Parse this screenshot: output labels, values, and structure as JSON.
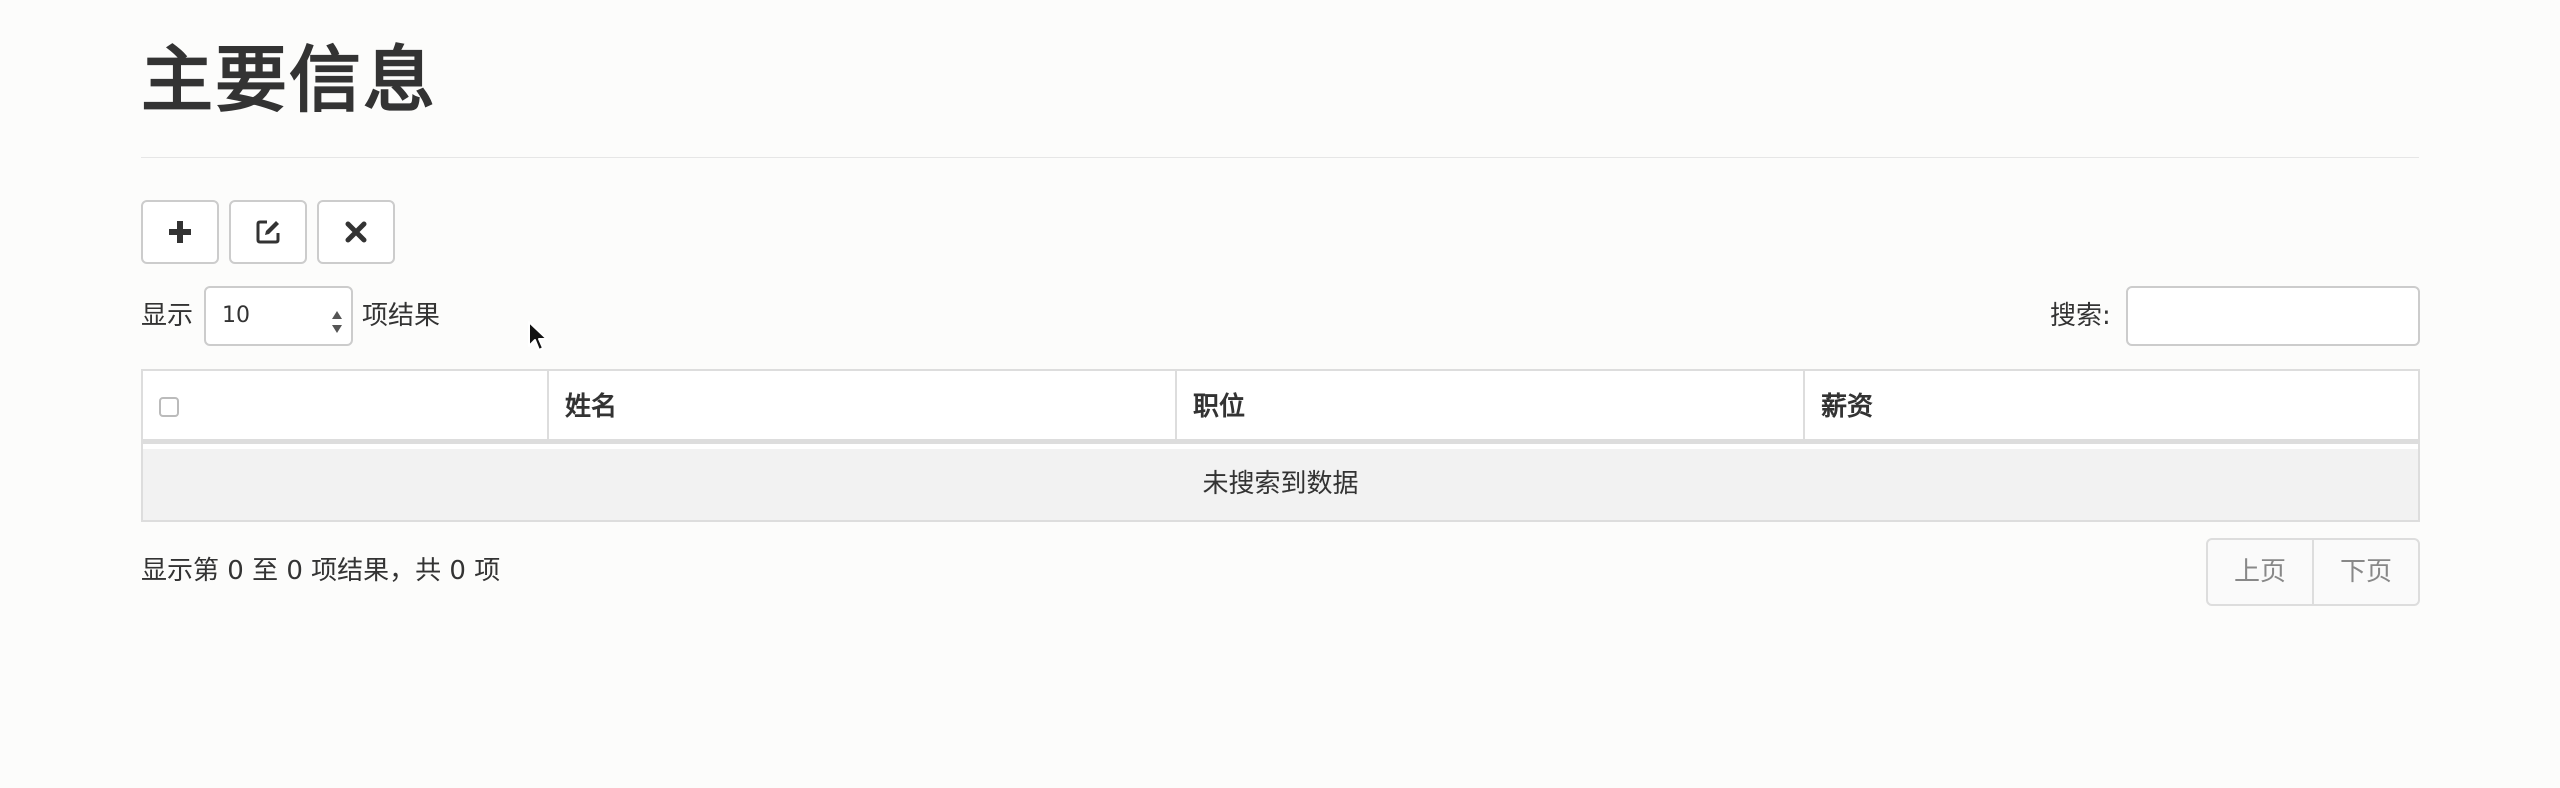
{
  "page": {
    "title": "主要信息"
  },
  "toolbar": {
    "add_icon": "plus-icon",
    "edit_icon": "edit-icon",
    "delete_icon": "close-icon"
  },
  "length_control": {
    "label": "显示",
    "value": "10",
    "suffix": "项结果"
  },
  "search": {
    "label": "搜索:",
    "value": ""
  },
  "table": {
    "columns": [
      "",
      "姓名",
      "职位",
      "薪资"
    ],
    "empty_message": "未搜索到数据"
  },
  "footer": {
    "info": "显示第 0 至 0 项结果，共 0 项",
    "prev_label": "上页",
    "next_label": "下页"
  },
  "colors": {
    "text": "#333333",
    "border": "#dddddd",
    "muted": "#888888"
  }
}
